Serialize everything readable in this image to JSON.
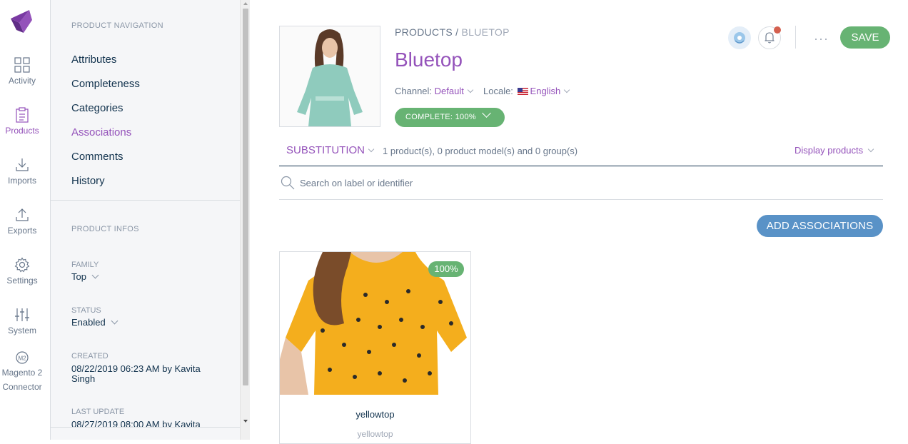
{
  "rail": {
    "items": [
      {
        "label": "Activity",
        "icon": "grid-icon"
      },
      {
        "label": "Products",
        "icon": "clipboard-icon"
      },
      {
        "label": "Imports",
        "icon": "import-icon"
      },
      {
        "label": "Exports",
        "icon": "export-icon"
      },
      {
        "label": "Settings",
        "icon": "gear-icon"
      },
      {
        "label": "System",
        "icon": "sliders-icon"
      },
      {
        "label": "Magento 2 Connector",
        "icon": "m2-icon"
      }
    ],
    "active": "Products"
  },
  "nav": {
    "section_title": "PRODUCT NAVIGATION",
    "links": [
      "Attributes",
      "Completeness",
      "Categories",
      "Associations",
      "Comments",
      "History"
    ],
    "active_link": "Associations",
    "infos_title": "PRODUCT INFOS",
    "family_label": "FAMILY",
    "family_value": "Top",
    "status_label": "STATUS",
    "status_value": "Enabled",
    "created_label": "CREATED",
    "created_value": "08/22/2019 06:23 AM by Kavita Singh",
    "updated_label": "LAST UPDATE",
    "updated_value": "08/27/2019 08:00 AM by Kavita"
  },
  "header": {
    "breadcrumb_root": "PRODUCTS",
    "breadcrumb_sep": " / ",
    "breadcrumb_current": "BLUETOP",
    "title": "Bluetop",
    "channel_label": "Channel:",
    "channel_value": "Default",
    "locale_label": "Locale:",
    "locale_value": "English",
    "complete_label": "COMPLETE: 100%",
    "save_label": "SAVE",
    "more_label": "···"
  },
  "associations": {
    "type": "SUBSTITUTION",
    "count_text": "1 product(s), 0 product model(s) and 0 group(s)",
    "display_label": "Display products",
    "search_placeholder": "Search on label or identifier",
    "add_label": "ADD ASSOCIATIONS",
    "cards": [
      {
        "label": "yellowtop",
        "identifier": "yellowtop",
        "completeness": "100%"
      }
    ]
  },
  "colors": {
    "accent_purple": "#9452ba",
    "success_green": "#67b373",
    "primary_blue": "#5992c7",
    "text_dark": "#11324d"
  }
}
